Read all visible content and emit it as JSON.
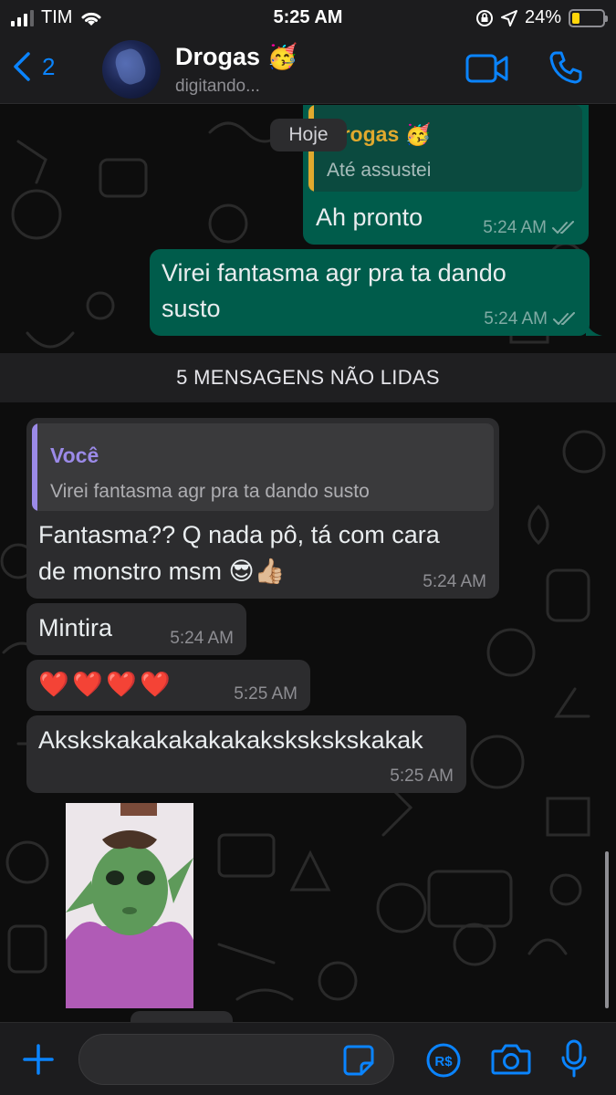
{
  "status_bar": {
    "carrier": "TIM",
    "time": "5:25 AM",
    "battery": "24%",
    "battery_level": 0.24
  },
  "header": {
    "back_count": "2",
    "contact_name": "Drogas 🥳",
    "contact_status": "digitando..."
  },
  "chat": {
    "date_label": "Hoje",
    "msg1": {
      "quote_name": "Drogas 🥳",
      "quote_text": "Até assustei",
      "text": "Ah pronto",
      "time": "5:24 AM"
    },
    "msg2": {
      "text_line1": "Virei fantasma agr pra ta dando",
      "text_line2": "susto",
      "time": "5:24 AM"
    },
    "unread_banner": "5 MENSAGENS NÃO LIDAS",
    "msg3": {
      "quote_name": "Você",
      "quote_text": "Virei fantasma agr pra ta dando susto",
      "text_line1": "Fantasma?? Q nada pô, tá com cara",
      "text_line2": "de monstro msm 😎👍🏼",
      "time": "5:24 AM"
    },
    "msg4": {
      "text": "Mintira",
      "time": "5:24 AM"
    },
    "msg5": {
      "text": "❤️ ❤️ ❤️ ❤️",
      "time": "5:25 AM"
    },
    "msg6": {
      "text": "Akskskakakakakakakskskskskakak",
      "time": "5:25 AM"
    }
  },
  "input": {
    "value": "",
    "placeholder": ""
  },
  "colors": {
    "accent": "#0a84ff",
    "outgoing_bubble": "#005c4b",
    "incoming_bubble": "#2c2c2e",
    "quote_self": "#9b8ae8",
    "quote_contact": "#e0a92e"
  }
}
